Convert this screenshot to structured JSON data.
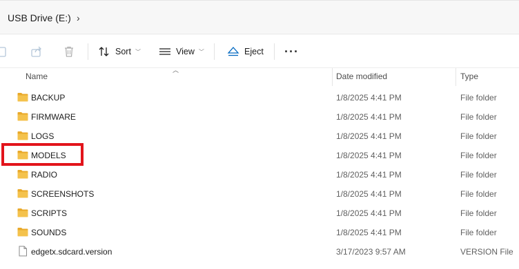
{
  "address": {
    "path": "USB Drive (E:)",
    "chevron": "›"
  },
  "toolbar": {
    "sort_label": "Sort",
    "view_label": "View",
    "eject_label": "Eject",
    "more_label": "···"
  },
  "columns": {
    "name": "Name",
    "date": "Date modified",
    "type": "Type"
  },
  "files": [
    {
      "name": "BACKUP",
      "date": "1/8/2025 4:41 PM",
      "type": "File folder",
      "icon": "folder-icon"
    },
    {
      "name": "FIRMWARE",
      "date": "1/8/2025 4:41 PM",
      "type": "File folder",
      "icon": "folder-icon"
    },
    {
      "name": "LOGS",
      "date": "1/8/2025 4:41 PM",
      "type": "File folder",
      "icon": "folder-icon"
    },
    {
      "name": "MODELS",
      "date": "1/8/2025 4:41 PM",
      "type": "File folder",
      "icon": "folder-icon",
      "highlighted": true
    },
    {
      "name": "RADIO",
      "date": "1/8/2025 4:41 PM",
      "type": "File folder",
      "icon": "folder-icon"
    },
    {
      "name": "SCREENSHOTS",
      "date": "1/8/2025 4:41 PM",
      "type": "File folder",
      "icon": "folder-icon"
    },
    {
      "name": "SCRIPTS",
      "date": "1/8/2025 4:41 PM",
      "type": "File folder",
      "icon": "folder-icon"
    },
    {
      "name": "SOUNDS",
      "date": "1/8/2025 4:41 PM",
      "type": "File folder",
      "icon": "folder-icon"
    },
    {
      "name": "edgetx.sdcard.version",
      "date": "3/17/2023 9:57 AM",
      "type": "VERSION File",
      "icon": "file-icon"
    }
  ],
  "colors": {
    "highlight": "#e2141b",
    "folder": "#f4c24c",
    "accent": "#0067c0"
  }
}
